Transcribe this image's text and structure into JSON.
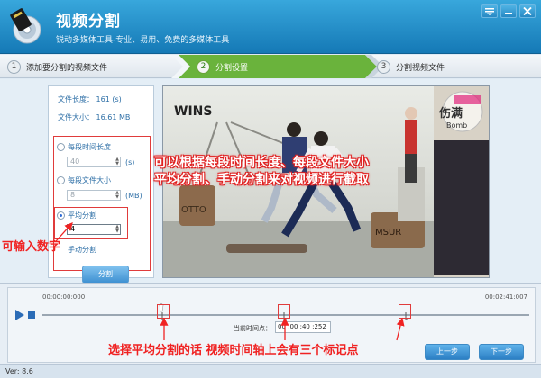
{
  "window": {
    "title": "视频分割",
    "subtitle": "锐动多媒体工具-专业、易用、免费的多媒体工具",
    "buttons": [
      "menu-icon",
      "minimize-icon",
      "close-icon"
    ]
  },
  "steps": [
    {
      "num": "1",
      "label": "添加要分割的视频文件",
      "active": false
    },
    {
      "num": "2",
      "label": "分割设置",
      "active": true
    },
    {
      "num": "3",
      "label": "分割视频文件",
      "active": false
    }
  ],
  "file_info": {
    "length_label": "文件长度：",
    "length_value": "161 (s)",
    "size_label": "文件大小：",
    "size_value": "16.61 MB"
  },
  "options": {
    "segment_length": {
      "label": "每段时间长度",
      "value": "40",
      "unit": "(s)",
      "selected": false
    },
    "segment_size": {
      "label": "每段文件大小",
      "value": "8",
      "unit": "(MB)",
      "selected": false
    },
    "even_split": {
      "label": "平均分割",
      "value": "4",
      "selected": true
    },
    "manual_split": {
      "label": "手动分割",
      "selected": false
    },
    "split_button": "分割"
  },
  "video": {
    "text_wins": "WINS",
    "text_bomb": "Bomb",
    "text_bomb_top": "伤满",
    "text_otto": "OTTO",
    "text_msur": "MSUR"
  },
  "timeline": {
    "start_time": "00:00:00:000",
    "end_time": "00:02:41:007",
    "current_label": "当前时间点：",
    "current_value": "00 :00 :40 :252",
    "prev_button": "上一步",
    "next_button": "下一步",
    "marker_positions": [
      0.25,
      0.5,
      0.75
    ]
  },
  "status": {
    "version": "Ver: 8.6"
  },
  "annotations": {
    "main_line1": "可以根据每段时间长度、每段文件大小",
    "main_line2": "平均分割、手动分割来对视频进行截取",
    "input_tip": "可输入数字",
    "bottom_tip": "选择平均分割的话 视频时间轴上会有三个标记点"
  },
  "colors": {
    "header": "#1f8cc9",
    "step_active": "#6ab33c",
    "annotation": "#f02222",
    "accent_button": "#3f91d2"
  }
}
